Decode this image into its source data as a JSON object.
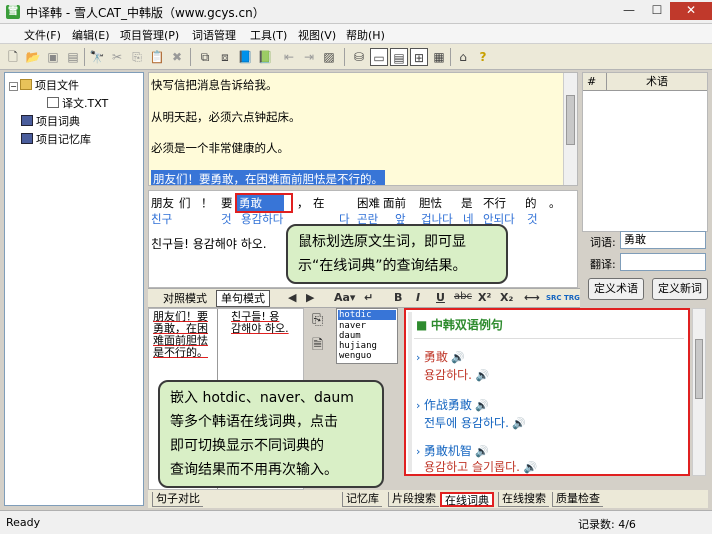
{
  "window": {
    "title": "中译韩 - 雪人CAT_中韩版（www.gcys.cn）",
    "app_icon": "雪",
    "min": "—",
    "max": "☐",
    "close": "✕"
  },
  "menu": [
    "文件(F)",
    "编辑(E)",
    "项目管理(P)",
    "词语管理",
    "工具(T)",
    "视图(V)",
    "帮助(H)"
  ],
  "tree": {
    "items": [
      {
        "label": "项目文件",
        "icon": "folder-icon"
      },
      {
        "label": "译文.TXT",
        "icon": "file-icon"
      },
      {
        "label": "项目词典",
        "icon": "book-icon"
      },
      {
        "label": "项目记忆库",
        "icon": "book-icon"
      }
    ]
  },
  "source": {
    "lines": [
      "快写信把消息告诉给我。",
      "从明天起，必须六点钟起床。",
      "必须是一个非常健康的人。",
      "朋友们！要勇敢，在困难面前胆怯是不行的。"
    ]
  },
  "segments": {
    "zh_tokens": [
      "朋友",
      "们",
      "！",
      "要",
      "勇敢",
      "，",
      "在",
      "困难",
      "面前",
      "胆怯",
      "是",
      "不行",
      "的",
      "。"
    ],
    "kr_tokens": [
      "친구",
      "것",
      "용감하다",
      "다",
      "곤란",
      "앞",
      "겁나다",
      "네",
      "안되다",
      "것"
    ],
    "translation": "친구들! 용감해야 하오.",
    "selected_word": "勇敢"
  },
  "callout1": {
    "lines": [
      "鼠标划选原文生词，即可显",
      "示“在线词典”的查询结果。"
    ]
  },
  "callout2": {
    "lines": [
      "嵌入 hotdic、naver、daum",
      "等多个韩语在线词典，点击",
      "即可切换显示不同词典的",
      "查询结果而不用再次输入。"
    ]
  },
  "terms": {
    "col_hash": "#",
    "col_term": "术语",
    "word_label": "词语:",
    "word_value": "勇敢",
    "trans_label": "翻译:",
    "trans_value": "",
    "define_term_btn": "定义术语",
    "define_word_btn": "定义新词"
  },
  "format_bar": {
    "tab_compare": "对照模式",
    "tab_single": "单句模式",
    "aa": "Aa▾",
    "bold": "B",
    "italic": "I",
    "underline": "U",
    "strike": "abc",
    "sup": "X²",
    "sub": "X₂",
    "src": "SRC",
    "trg": "TRG"
  },
  "compare": {
    "zh": [
      "朋友们！要",
      "勇敢，在困",
      "难面前胆怯",
      "是不行的。"
    ],
    "kr": [
      "친구들! 용",
      "감해야 하오."
    ]
  },
  "dict_list": [
    "hotdic",
    "naver",
    "daum",
    "hujiang",
    "wenguo"
  ],
  "dict_result": {
    "title": "中韩双语例句",
    "entries": [
      {
        "cn": "勇敢",
        "kr": "용감하다."
      },
      {
        "cn": "作战勇敢",
        "kr": "전투에 용감하다."
      },
      {
        "cn": "勇敢机智",
        "kr": "용감하고 슬기롭다."
      }
    ]
  },
  "bottom_tabs": [
    "句子对比",
    "记忆库",
    "片段搜索",
    "在线词典",
    "在线搜索",
    "质量检查"
  ],
  "status": {
    "left": "Ready",
    "right": "记录数: 4/6"
  },
  "colors": {
    "highlight": "#3875d7",
    "red_frame": "#e02020",
    "callout_bg": "#d9efc6"
  }
}
